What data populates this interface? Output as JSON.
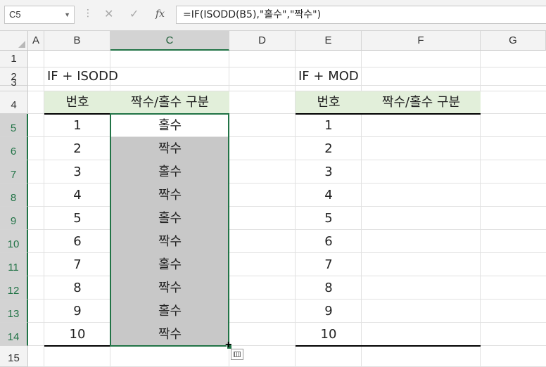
{
  "formula_bar": {
    "name_box": "C5",
    "name_box_dropdown_icon": "chevron-down-icon",
    "cancel_icon": "close-icon",
    "enter_icon": "check-icon",
    "fx_label": "fx",
    "formula": "=IF(ISODD(B5),\"홀수\",\"짝수\")"
  },
  "columns": [
    "A",
    "B",
    "C",
    "D",
    "E",
    "F",
    "G"
  ],
  "selected_column": "C",
  "rows": [
    "1",
    "2",
    "3",
    "4",
    "5",
    "6",
    "7",
    "8",
    "9",
    "10",
    "11",
    "12",
    "13",
    "14",
    "15"
  ],
  "left_table": {
    "title": "IF +  ISODD",
    "headers": [
      "번호",
      "짝수/홀수 구분"
    ],
    "numbers": [
      "1",
      "2",
      "3",
      "4",
      "5",
      "6",
      "7",
      "8",
      "9",
      "10"
    ],
    "results": [
      "홀수",
      "짝수",
      "홀수",
      "짝수",
      "홀수",
      "짝수",
      "홀수",
      "짝수",
      "홀수",
      "짝수"
    ]
  },
  "right_table": {
    "title": "IF + MOD",
    "headers": [
      "번호",
      "짝수/홀수 구분"
    ],
    "numbers": [
      "1",
      "2",
      "3",
      "4",
      "5",
      "6",
      "7",
      "8",
      "9",
      "10"
    ]
  },
  "colors": {
    "header_fill": "#e2efda",
    "selection": "#217346",
    "shaded_fill": "#c8c8c8"
  }
}
